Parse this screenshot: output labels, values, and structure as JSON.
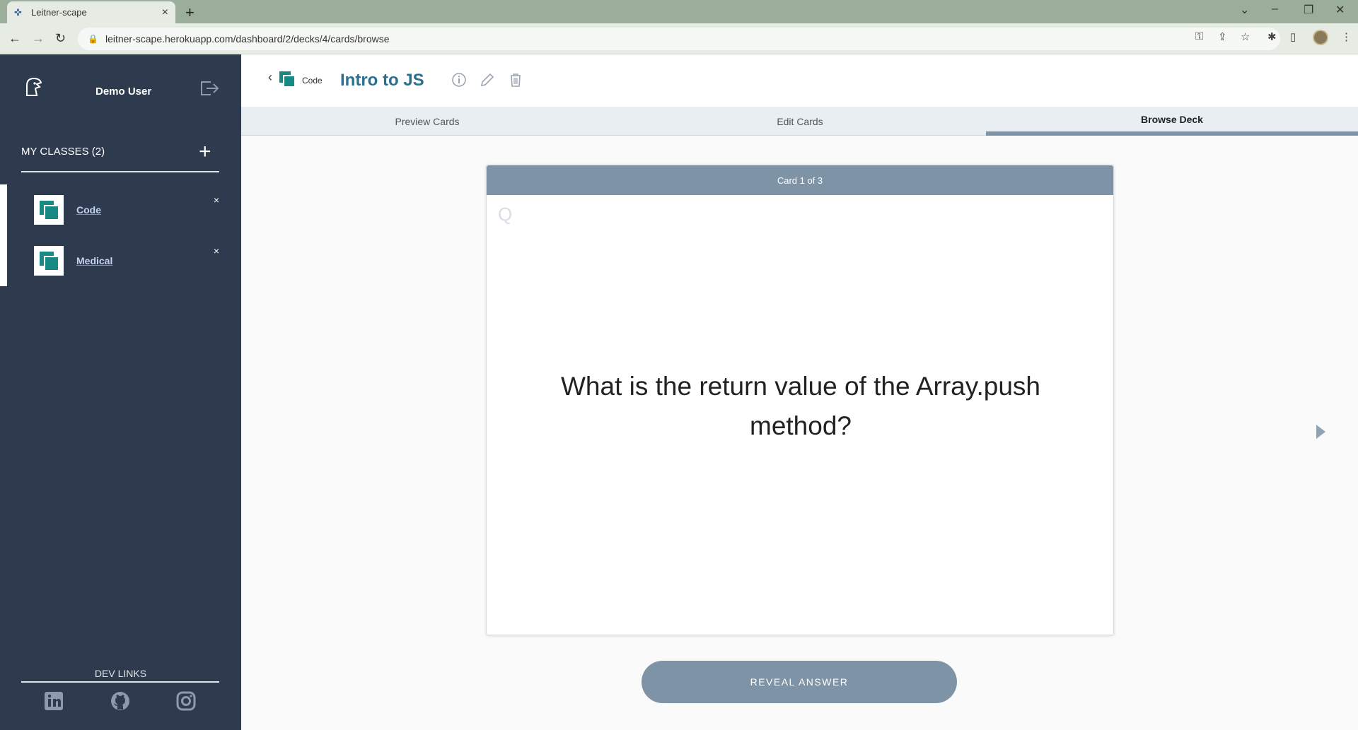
{
  "browser": {
    "tab_title": "Leitner-scape",
    "url": "leitner-scape.herokuapp.com/dashboard/2/decks/4/cards/browse"
  },
  "sidebar": {
    "username": "Demo User",
    "classes_heading": "MY CLASSES (2)",
    "add_symbol": "+",
    "classes": [
      {
        "name": "Code",
        "remove": "×"
      },
      {
        "name": "Medical",
        "remove": "×"
      }
    ],
    "dev_links_label": "DEV LINKS",
    "dev_links": [
      "linkedin-icon",
      "github-icon",
      "instagram-icon"
    ]
  },
  "header": {
    "breadcrumb_label": "Code",
    "deck_title": "Intro to JS"
  },
  "tabs": [
    {
      "label": "Preview Cards",
      "active": false
    },
    {
      "label": "Edit Cards",
      "active": false
    },
    {
      "label": "Browse Deck",
      "active": true
    }
  ],
  "card": {
    "counter": "Card 1 of 3",
    "side_marker": "Q",
    "text": "What is the return value of the Array.push method?"
  },
  "reveal_button": "REVEAL ANSWER",
  "colors": {
    "sidebar_bg": "#2e3b4e",
    "accent_slate": "#7f93a6",
    "teal": "#188a86",
    "title_blue": "#2a6f8f"
  }
}
